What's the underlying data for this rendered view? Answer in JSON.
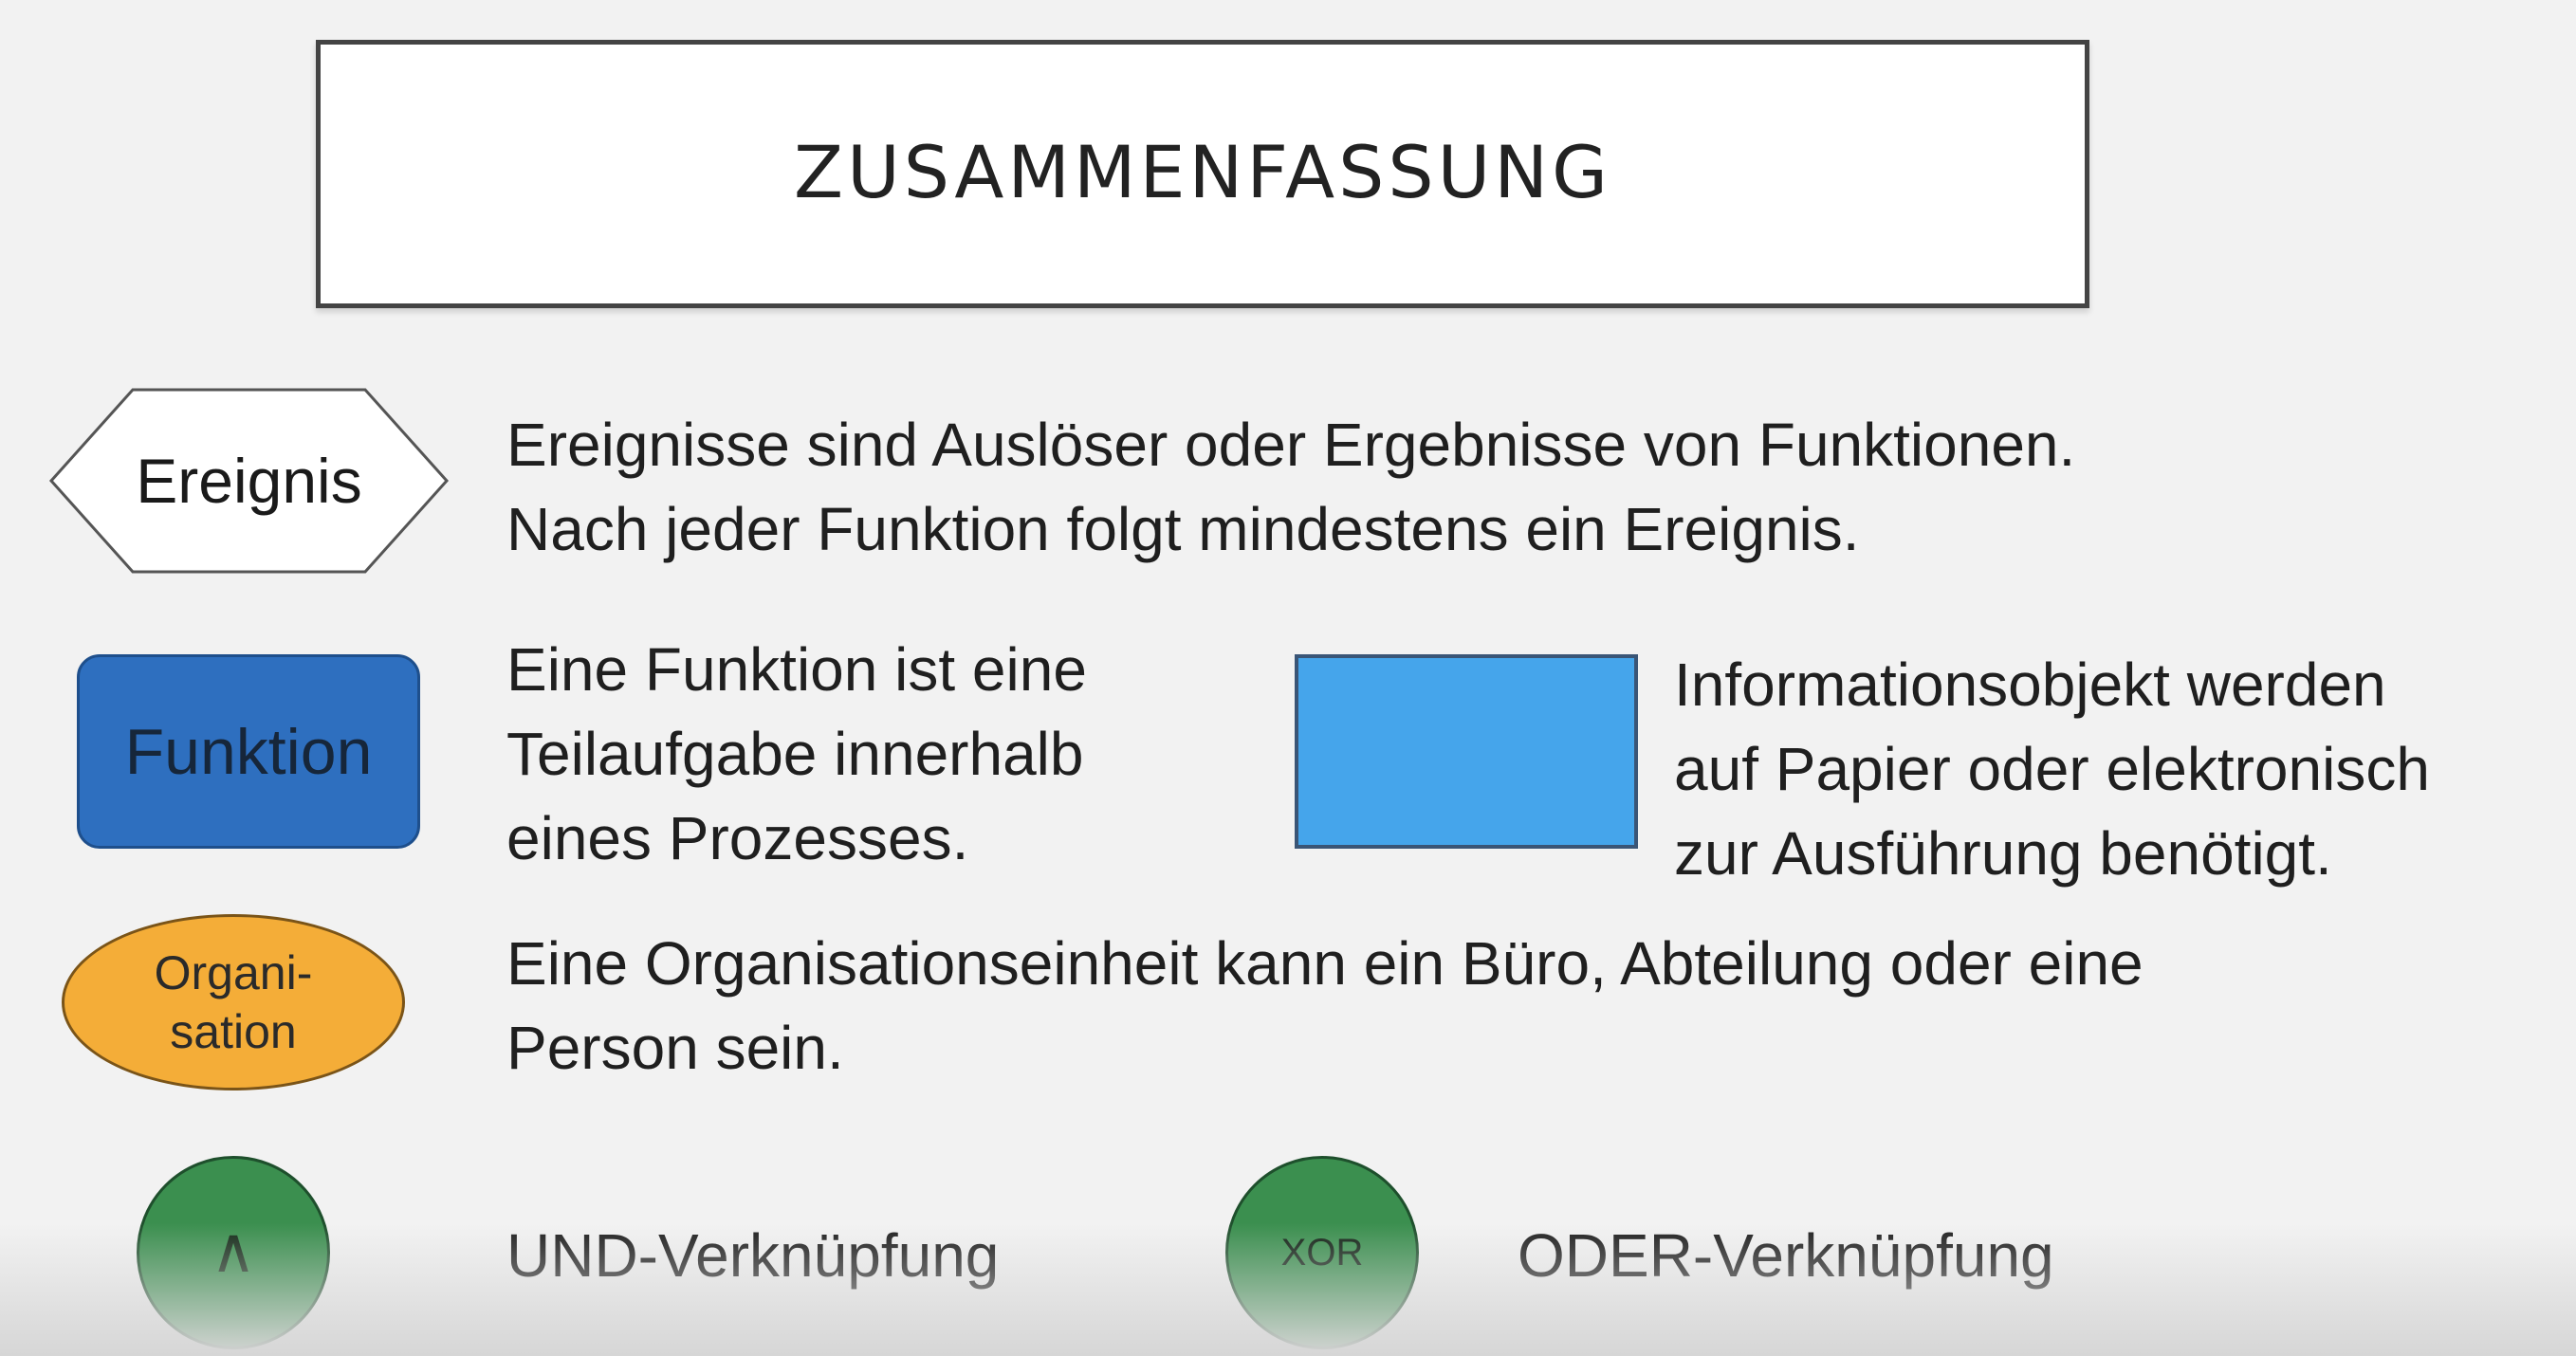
{
  "title": "ZUSAMMENFASSUNG",
  "colors": {
    "background": "#f2f2f2",
    "title_border": "#444444",
    "function_fill": "#2e6fbf",
    "info_object_fill": "#45a5eb",
    "organisation_fill": "#f4ad38",
    "connector_fill": "#3b8f4f"
  },
  "event": {
    "symbol_label": "Ereignis",
    "description": [
      "Ereignisse sind Auslöser oder Ergebnisse von Funktionen.",
      "Nach jeder Funktion folgt mindestens ein Ereignis."
    ]
  },
  "function": {
    "symbol_label": "Funktion",
    "description": [
      "Eine Funktion ist eine",
      "Teilaufgabe innerhalb",
      "eines Prozesses."
    ]
  },
  "information_object": {
    "description": [
      "Informationsobjekt werden",
      "auf Papier oder elektronisch",
      "zur Ausführung benötigt."
    ]
  },
  "organisation": {
    "symbol_label": [
      "Organi-",
      "sation"
    ],
    "description": [
      "Eine Organisationseinheit kann ein Büro, Abteilung oder eine",
      "Person sein."
    ]
  },
  "and_connector": {
    "symbol_label": "∧",
    "description": "UND-Verknüpfung"
  },
  "xor_connector": {
    "symbol_label": "XOR",
    "description": "ODER-Verknüpfung"
  }
}
